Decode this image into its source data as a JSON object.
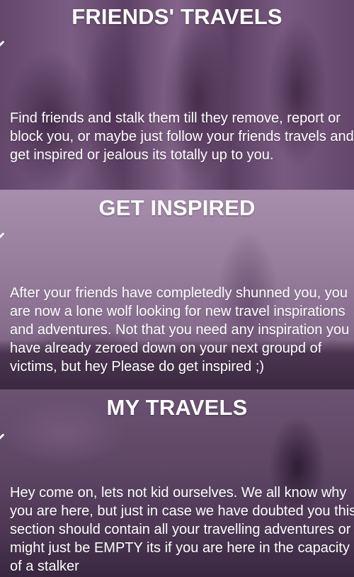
{
  "sections": [
    {
      "title": "FRIENDS' TRAVELS",
      "description": "Find friends and stalk them till they remove, report or block you, or maybe just follow your friends travels and get inspired or jealous its totally up to you."
    },
    {
      "title": "GET INSPIRED",
      "description": "After your friends have completedly shunned you, you are now a lone wolf looking for new travel inspirations and adventures. Not that you need any inspiration you have already zeroed down on your next groupd of victims, but hey Please do get inspired ;)"
    },
    {
      "title": "MY TRAVELS",
      "description": "Hey come on, lets not kid ourselves. We all know why you are here, but just in case we have doubted you this section should contain all your travelling adventures or it might just be EMPTY its if you are here in the capacity of a stalker"
    }
  ],
  "icons": {
    "expand": "chevron-down-icon"
  },
  "colors": {
    "tint": "#7a4f86",
    "text": "#ffffff"
  }
}
